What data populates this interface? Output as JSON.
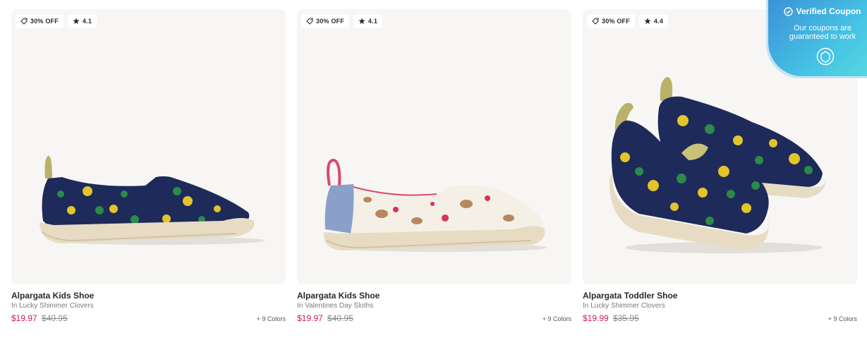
{
  "products": [
    {
      "discount": "30% OFF",
      "rating": "4.1",
      "title": "Alpargata Kids Shoe",
      "subtitle": "In Lucky Shimmer Clovers",
      "price_now": "$19.97",
      "price_was": "$40.95",
      "colors": "+ 9 Colors"
    },
    {
      "discount": "30% OFF",
      "rating": "4.1",
      "title": "Alpargata Kids Shoe",
      "subtitle": "In Valentines Day Sloths",
      "price_now": "$19.97",
      "price_was": "$40.95",
      "colors": "+ 9 Colors"
    },
    {
      "discount": "30% OFF",
      "rating": "4.4",
      "title": "Alpargata Toddler Shoe",
      "subtitle": "In Lucky Shimmer Clovers",
      "price_now": "$19.99",
      "price_was": "$35.95",
      "colors": "+ 9 Colors"
    }
  ],
  "coupon": {
    "title": "Verified Coupon",
    "message": "Our coupons are guaranteed to work",
    "icons": [
      "check-circle-icon",
      "shield-icon"
    ]
  },
  "icons": {
    "discount": "tag-icon",
    "rating": "star-icon"
  },
  "colors": {
    "sale_price": "#d71760",
    "card_bg": "#f7f6f4",
    "coupon_gradient_start": "#3a8fd6",
    "coupon_gradient_end": "#56d9e0"
  }
}
